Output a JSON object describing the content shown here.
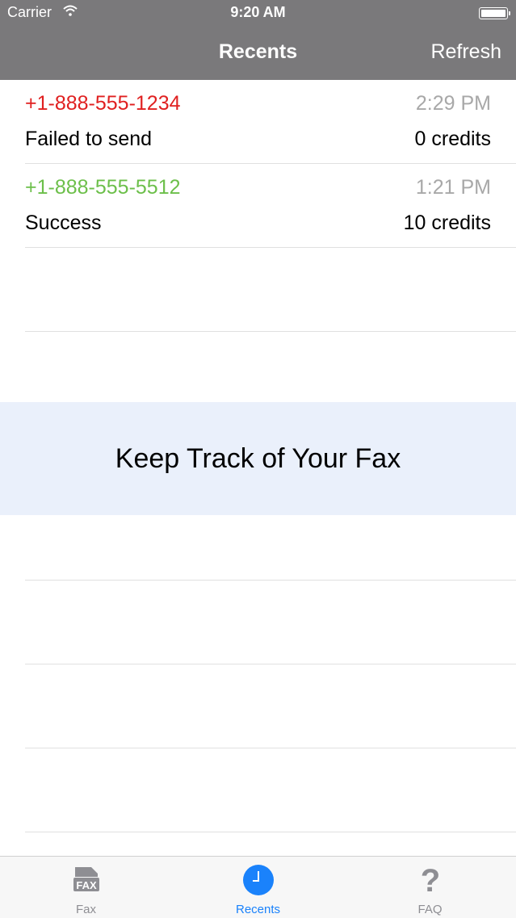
{
  "status_bar": {
    "carrier": "Carrier",
    "time": "9:20 AM"
  },
  "nav": {
    "title": "Recents",
    "refresh_label": "Refresh"
  },
  "recents": [
    {
      "number": "+1-888-555-1234",
      "time": "2:29 PM",
      "status": "Failed to send",
      "credits": "0 credits",
      "number_color": "#e02020"
    },
    {
      "number": "+1-888-555-5512",
      "time": "1:21 PM",
      "status": "Success",
      "credits": "10 credits",
      "number_color": "#6cbf4a"
    }
  ],
  "banner": {
    "text": "Keep Track of Your Fax"
  },
  "tabs": [
    {
      "label": "Fax",
      "icon": "fax-icon",
      "active": false
    },
    {
      "label": "Recents",
      "icon": "clock-icon",
      "active": true
    },
    {
      "label": "FAQ",
      "icon": "question-mark-icon",
      "active": false
    }
  ],
  "colors": {
    "header_bg": "#7a797b",
    "accent": "#1a82fb",
    "banner_bg": "#eaf0fb"
  }
}
